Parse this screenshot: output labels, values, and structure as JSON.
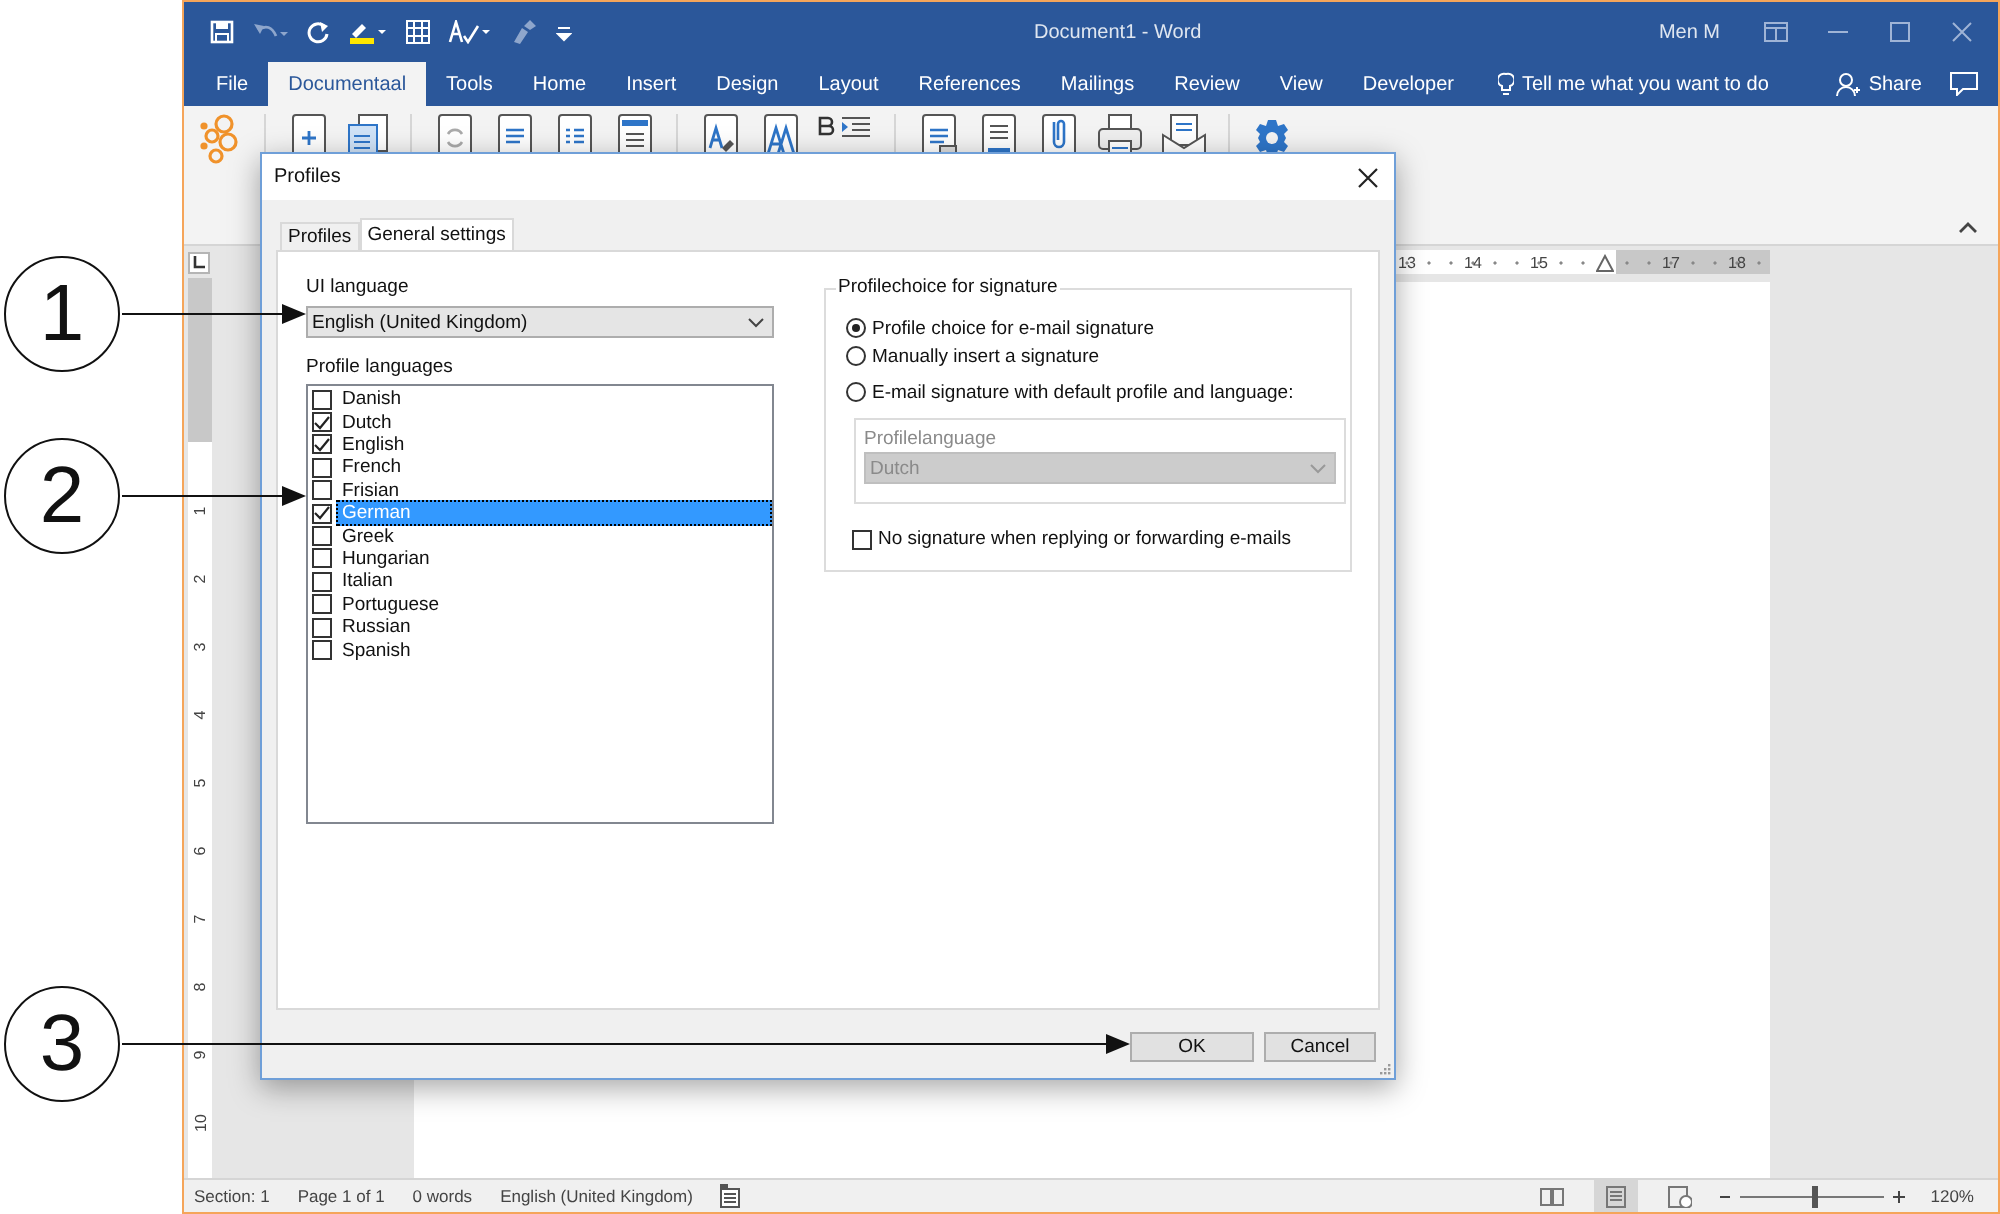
{
  "window": {
    "title": "Document1  -  Word",
    "user": "Men M"
  },
  "ribbon_tabs": [
    {
      "label": "File",
      "selected": false
    },
    {
      "label": "Documentaal",
      "selected": true
    },
    {
      "label": "Tools",
      "selected": false
    },
    {
      "label": "Home",
      "selected": false
    },
    {
      "label": "Insert",
      "selected": false
    },
    {
      "label": "Design",
      "selected": false
    },
    {
      "label": "Layout",
      "selected": false
    },
    {
      "label": "References",
      "selected": false
    },
    {
      "label": "Mailings",
      "selected": false
    },
    {
      "label": "Review",
      "selected": false
    },
    {
      "label": "View",
      "selected": false
    },
    {
      "label": "Developer",
      "selected": false
    }
  ],
  "tell_me": {
    "placeholder": "Tell me what you want to do"
  },
  "share": "Share",
  "horizontal_ruler": [
    {
      "kind": "number",
      "label": "13"
    },
    {
      "kind": "number",
      "label": "14"
    },
    {
      "kind": "number",
      "label": "15"
    },
    {
      "kind": "indent-marker"
    },
    {
      "kind": "number",
      "label": "17"
    },
    {
      "kind": "number",
      "label": "18"
    }
  ],
  "vertical_ruler": [
    "1",
    "2",
    "3",
    "4",
    "5",
    "6",
    "7",
    "8",
    "9",
    "10"
  ],
  "dialog": {
    "title": "Profiles",
    "tabs": [
      {
        "label": "Profiles",
        "selected": false
      },
      {
        "label": "General settings",
        "selected": true
      }
    ],
    "ui_language": {
      "label": "UI language",
      "value": "English (United Kingdom)"
    },
    "profile_languages": {
      "label": "Profile languages",
      "items": [
        {
          "label": "Danish",
          "checked": false,
          "selected": false
        },
        {
          "label": "Dutch",
          "checked": true,
          "selected": false
        },
        {
          "label": "English",
          "checked": true,
          "selected": false
        },
        {
          "label": "French",
          "checked": false,
          "selected": false
        },
        {
          "label": "Frisian",
          "checked": false,
          "selected": false
        },
        {
          "label": "German",
          "checked": true,
          "selected": true
        },
        {
          "label": "Greek",
          "checked": false,
          "selected": false
        },
        {
          "label": "Hungarian",
          "checked": false,
          "selected": false
        },
        {
          "label": "Italian",
          "checked": false,
          "selected": false
        },
        {
          "label": "Portuguese",
          "checked": false,
          "selected": false
        },
        {
          "label": "Russian",
          "checked": false,
          "selected": false
        },
        {
          "label": "Spanish",
          "checked": false,
          "selected": false
        }
      ]
    },
    "signature": {
      "legend": "Profilechoice for signature",
      "options": [
        {
          "label": "Profile choice for e-mail signature",
          "selected": true
        },
        {
          "label": "Manually insert a signature",
          "selected": false
        },
        {
          "label": "E-mail signature with default profile and language:",
          "selected": false
        }
      ],
      "profilelanguage": {
        "label": "Profilelanguage",
        "value": "Dutch",
        "disabled": true
      },
      "no_signature": {
        "label": "No signature when replying or forwarding e-mails",
        "checked": false
      }
    },
    "buttons": [
      "OK",
      "Cancel"
    ]
  },
  "status_bar": {
    "items": [
      "Section: 1",
      "Page 1 of 1",
      "0 words",
      "English (United Kingdom)"
    ],
    "zoom_slider": {
      "level": 0.51
    },
    "zoom": "120%"
  },
  "callouts": [
    {
      "number": "1"
    },
    {
      "number": "2"
    },
    {
      "number": "3"
    }
  ]
}
